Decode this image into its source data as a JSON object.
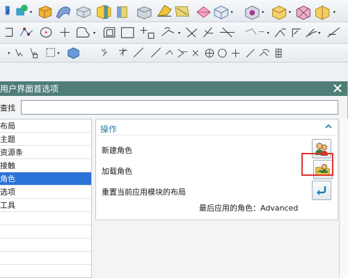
{
  "dialog": {
    "title": "用户界面首选项",
    "search_label": "查找",
    "search_value": "",
    "nav_items": [
      {
        "label": "布局"
      },
      {
        "label": "主题"
      },
      {
        "label": "资源条"
      },
      {
        "label": "接触"
      },
      {
        "label": "角色",
        "selected": true
      },
      {
        "label": "选项"
      },
      {
        "label": "工具"
      }
    ],
    "section_title": "操作",
    "operations": [
      {
        "label": "新建角色",
        "icon": "new-role-icon"
      },
      {
        "label": "加载角色",
        "icon": "load-role-icon"
      },
      {
        "label": "重置当前应用模块的布局",
        "icon": "reset-layout-icon"
      }
    ],
    "last_role_text": "最后应用的角色：Advanced"
  },
  "colors": {
    "titlebar": "#507d78",
    "selection": "#2a72d8",
    "section_title": "#2b7fa5",
    "highlight": "#e0302a"
  },
  "toolbar_icons": {
    "row1": [
      "sketch-icon",
      "shape-icon",
      "box-icon",
      "sweep-icon",
      "block-icon",
      "cylinder-icon",
      "chamfer-icon",
      "blend-icon",
      "surface-icon",
      "shell-icon",
      "assembly-icon",
      "settings-icon",
      "paint-icon",
      "material-icon",
      "solid-icon"
    ],
    "row2": [
      "rectangle-icon",
      "spline-icon",
      "circle-icon",
      "point-icon",
      "fillet-sketch-icon",
      "offset-icon",
      "square-icon",
      "snap-icon",
      "constraint-icon",
      "trim-icon",
      "dimension-icon",
      "extend-icon",
      "mirror-icon",
      "angle-icon",
      "measure-icon",
      "tangent-icon",
      "line-icon"
    ],
    "row3": [
      "move-icon",
      "select-icon",
      "filter-icon",
      "selection-box-icon",
      "cube-icon",
      "snap-end-icon",
      "snap-mid-icon",
      "snap-line-icon",
      "snap-arc-icon",
      "snap-center-icon",
      "snap-circle-icon",
      "snap-cross-icon",
      "snap-tangent-icon",
      "snap-point-icon",
      "grid-icon"
    ]
  }
}
